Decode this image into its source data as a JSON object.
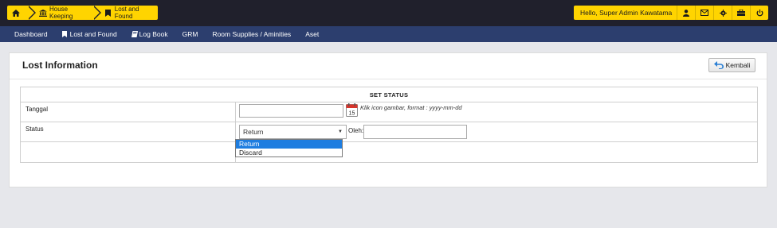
{
  "breadcrumb": {
    "items": [
      {
        "label": "",
        "icon": "home-icon"
      },
      {
        "label": "House Keeping",
        "icon": "bank-icon"
      },
      {
        "label": "Lost and Found",
        "icon": "bookmark-icon"
      }
    ]
  },
  "user": {
    "greeting": "Hello, Super Admin Kawatama",
    "buttons": [
      "user-icon",
      "envelope-icon",
      "gear-icon",
      "briefcase-icon",
      "power-icon"
    ]
  },
  "nav": {
    "items": [
      {
        "label": "Dashboard",
        "icon": ""
      },
      {
        "label": "Lost and Found",
        "icon": "bookmark-icon"
      },
      {
        "label": "Log Book",
        "icon": "book-icon"
      },
      {
        "label": "GRM",
        "icon": ""
      },
      {
        "label": "Room Supplies / Aminities",
        "icon": ""
      },
      {
        "label": "Aset",
        "icon": ""
      }
    ]
  },
  "panel": {
    "title": "Lost Information",
    "back_label": "Kembali"
  },
  "form": {
    "header": "SET STATUS",
    "tanggal_label": "Tanggal",
    "tanggal_value": "",
    "tanggal_hint": "Klik icon gambar, format : yyyy-mm-dd",
    "calendar_day": "15",
    "status_label": "Status",
    "status_selected": "Return",
    "status_options": [
      "Return",
      "Discard"
    ],
    "oleh_label": "Oleh:",
    "oleh_value": ""
  },
  "colors": {
    "topbar": "#20202c",
    "accent_yellow": "#ffd400",
    "navbar": "#2c3e6e",
    "select_highlight": "#1e7de0"
  }
}
